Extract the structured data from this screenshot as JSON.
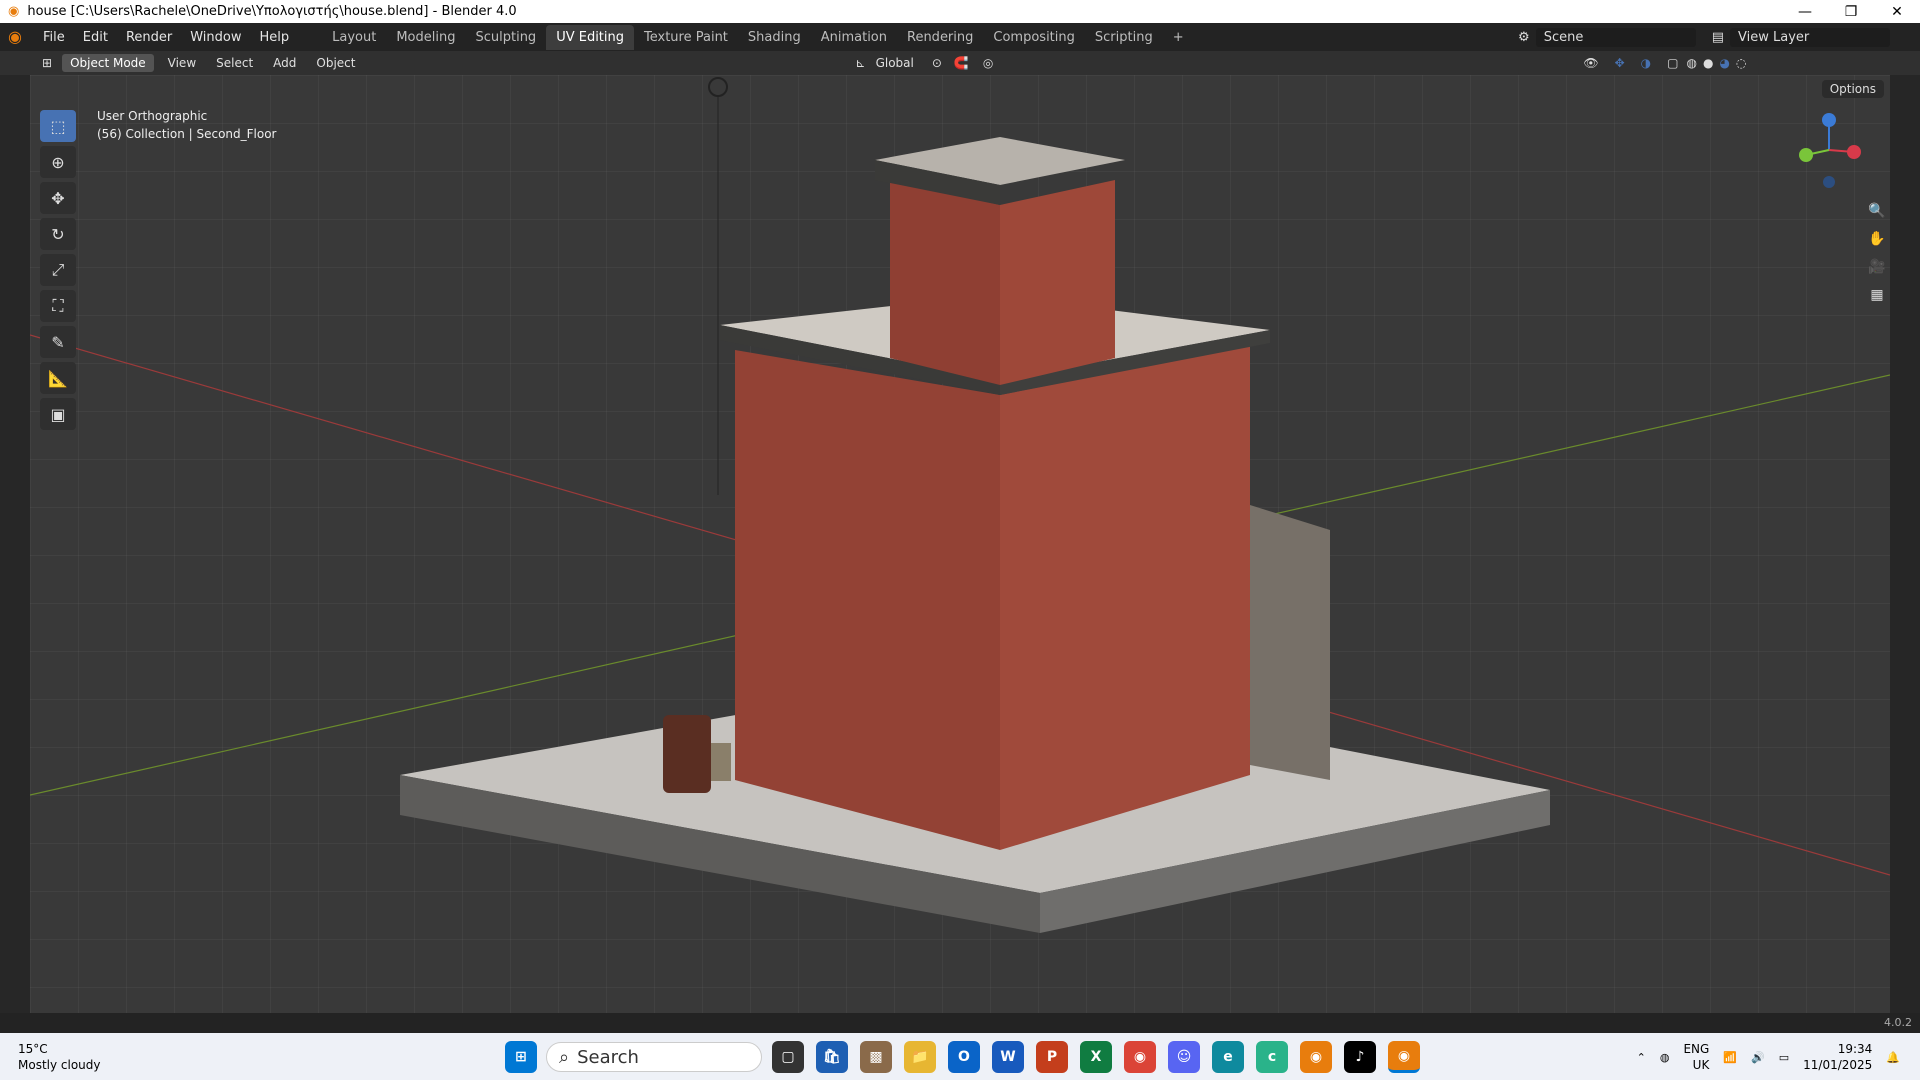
{
  "window": {
    "title": "house [C:\\Users\\Rachele\\OneDrive\\Υπολογιστής\\house.blend] - Blender 4.0"
  },
  "menu": [
    "File",
    "Edit",
    "Render",
    "Window",
    "Help"
  ],
  "tabs": [
    "Layout",
    "Modeling",
    "Sculpting",
    "UV Editing",
    "Texture Paint",
    "Shading",
    "Animation",
    "Rendering",
    "Compositing",
    "Scripting"
  ],
  "active_tab": "UV Editing",
  "scene": {
    "name": "Scene",
    "view_layer": "View Layer"
  },
  "header": {
    "mode": "Object Mode",
    "menus": [
      "View",
      "Select",
      "Add",
      "Object"
    ],
    "transform": "Global",
    "options": "Options"
  },
  "viewport": {
    "view": "User Orthographic",
    "collection": "(56) Collection | Second_Floor"
  },
  "toolbar_icons": [
    "select-box-icon",
    "cursor-icon",
    "move-icon",
    "rotate-icon",
    "scale-icon",
    "transform-icon",
    "annotate-icon",
    "measure-icon",
    "add-cube-icon"
  ],
  "status": {
    "version": "4.0.2"
  },
  "taskbar": {
    "weather_temp": "15°C",
    "weather_desc": "Mostly cloudy",
    "search": "Search",
    "lang": "ENG",
    "region": "UK",
    "time": "19:34",
    "date": "11/01/2025"
  },
  "colors": {
    "accent": "#4772b3",
    "blender_orange": "#e87d0d"
  }
}
